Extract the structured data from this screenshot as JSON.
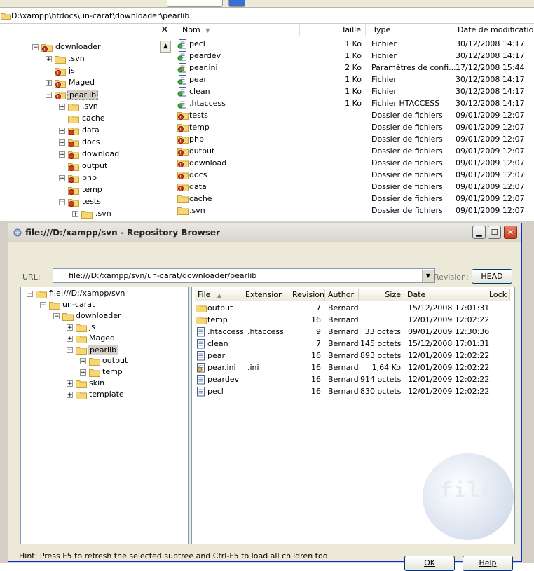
{
  "explorer": {
    "address": "D:\\xampp\\htdocs\\un-carat\\downloader\\pearlib",
    "folders_close": "×",
    "tree": [
      {
        "label": "downloader",
        "level": 0,
        "pm": "−",
        "icon": "folder-svn-icon"
      },
      {
        "label": ".svn",
        "level": 1,
        "pm": "+",
        "icon": "folder-icon"
      },
      {
        "label": "js",
        "level": 1,
        "pm": "",
        "icon": "folder-svn-icon"
      },
      {
        "label": "Maged",
        "level": 1,
        "pm": "+",
        "icon": "folder-svn-icon"
      },
      {
        "label": "pearlib",
        "level": 1,
        "pm": "−",
        "icon": "folder-svn-icon",
        "selected": true
      },
      {
        "label": ".svn",
        "level": 2,
        "pm": "+",
        "icon": "folder-icon"
      },
      {
        "label": "cache",
        "level": 2,
        "pm": "",
        "icon": "folder-icon"
      },
      {
        "label": "data",
        "level": 2,
        "pm": "+",
        "icon": "folder-svn-icon"
      },
      {
        "label": "docs",
        "level": 2,
        "pm": "+",
        "icon": "folder-svn-icon"
      },
      {
        "label": "download",
        "level": 2,
        "pm": "+",
        "icon": "folder-svn-icon"
      },
      {
        "label": "output",
        "level": 2,
        "pm": "",
        "icon": "folder-svn-icon"
      },
      {
        "label": "php",
        "level": 2,
        "pm": "+",
        "icon": "folder-svn-icon"
      },
      {
        "label": "temp",
        "level": 2,
        "pm": "",
        "icon": "folder-svn-icon"
      },
      {
        "label": "tests",
        "level": 2,
        "pm": "−",
        "icon": "folder-svn-icon"
      },
      {
        "label": ".svn",
        "level": 3,
        "pm": "+",
        "icon": "folder-icon"
      }
    ],
    "columns": {
      "name": "Nom",
      "size": "Taille",
      "type": "Type",
      "modified": "Date de modification"
    },
    "rows": [
      {
        "name": "pecl",
        "size": "1 Ko",
        "type": "Fichier",
        "modified": "30/12/2008 14:17"
      },
      {
        "name": "peardev",
        "size": "1 Ko",
        "type": "Fichier",
        "modified": "30/12/2008 14:17"
      },
      {
        "name": "pear.ini",
        "size": "2 Ko",
        "type": "Paramètres de confi...",
        "modified": "17/12/2008 15:44"
      },
      {
        "name": "pear",
        "size": "1 Ko",
        "type": "Fichier",
        "modified": "30/12/2008 14:17"
      },
      {
        "name": "clean",
        "size": "1 Ko",
        "type": "Fichier",
        "modified": "30/12/2008 14:17"
      },
      {
        "name": ".htaccess",
        "size": "1 Ko",
        "type": "Fichier HTACCESS",
        "modified": "30/12/2008 14:17"
      },
      {
        "name": "tests",
        "size": "",
        "type": "Dossier de fichiers",
        "modified": "09/01/2009 12:07"
      },
      {
        "name": "temp",
        "size": "",
        "type": "Dossier de fichiers",
        "modified": "09/01/2009 12:07"
      },
      {
        "name": "php",
        "size": "",
        "type": "Dossier de fichiers",
        "modified": "09/01/2009 12:07"
      },
      {
        "name": "output",
        "size": "",
        "type": "Dossier de fichiers",
        "modified": "09/01/2009 12:07"
      },
      {
        "name": "download",
        "size": "",
        "type": "Dossier de fichiers",
        "modified": "09/01/2009 12:07"
      },
      {
        "name": "docs",
        "size": "",
        "type": "Dossier de fichiers",
        "modified": "09/01/2009 12:07"
      },
      {
        "name": "data",
        "size": "",
        "type": "Dossier de fichiers",
        "modified": "09/01/2009 12:07"
      },
      {
        "name": "cache",
        "size": "",
        "type": "Dossier de fichiers",
        "modified": "09/01/2009 12:07"
      },
      {
        "name": ".svn",
        "size": "",
        "type": "Dossier de fichiers",
        "modified": "09/01/2009 12:07"
      }
    ],
    "row_icons": [
      "file-svn-icon",
      "file-svn-icon",
      "settings-file-svn-icon",
      "file-svn-icon",
      "file-svn-icon",
      "file-svn-icon",
      "folder-svn-icon",
      "folder-svn-icon",
      "folder-svn-icon",
      "folder-svn-icon",
      "folder-svn-icon",
      "folder-svn-icon",
      "folder-svn-icon",
      "folder-icon",
      "folder-icon"
    ]
  },
  "dialog": {
    "title": "file:///D:/xampp/svn - Repository Browser",
    "url_label": "URL:",
    "url_value": "file:///D:/xampp/svn/un-carat/downloader/pearlib",
    "revision_label": "Revision:",
    "head_button": "HEAD",
    "tree": [
      {
        "label": "file:///D:/xampp/svn",
        "level": 0,
        "pm": "−"
      },
      {
        "label": "un-carat",
        "level": 1,
        "pm": "−"
      },
      {
        "label": "downloader",
        "level": 2,
        "pm": "−"
      },
      {
        "label": "js",
        "level": 3,
        "pm": "+"
      },
      {
        "label": "Maged",
        "level": 3,
        "pm": "+"
      },
      {
        "label": "pearlib",
        "level": 3,
        "pm": "−",
        "selected": true
      },
      {
        "label": "output",
        "level": 4,
        "pm": "+"
      },
      {
        "label": "temp",
        "level": 4,
        "pm": "+"
      },
      {
        "label": "skin",
        "level": 3,
        "pm": "+"
      },
      {
        "label": "template",
        "level": 3,
        "pm": "+"
      }
    ],
    "columns": {
      "file": "File",
      "extension": "Extension",
      "revision": "Revision",
      "author": "Author",
      "size": "Size",
      "date": "Date",
      "lock": "Lock"
    },
    "files": [
      {
        "file": "output",
        "extension": "",
        "revision": "7",
        "author": "Bernard",
        "size": "",
        "date": "15/12/2008 17:01:31",
        "icon": "folder-icon"
      },
      {
        "file": "temp",
        "extension": "",
        "revision": "16",
        "author": "Bernard",
        "size": "",
        "date": "12/01/2009 12:02:22",
        "icon": "folder-icon"
      },
      {
        "file": ".htaccess",
        "extension": ".htaccess",
        "revision": "9",
        "author": "Bernard",
        "size": "33 octets",
        "date": "09/01/2009 12:30:36",
        "icon": "file-icon"
      },
      {
        "file": "clean",
        "extension": "",
        "revision": "7",
        "author": "Bernard",
        "size": "145 octets",
        "date": "15/12/2008 17:01:31",
        "icon": "file-icon"
      },
      {
        "file": "pear",
        "extension": "",
        "revision": "16",
        "author": "Bernard",
        "size": "893 octets",
        "date": "12/01/2009 12:02:22",
        "icon": "file-icon"
      },
      {
        "file": "pear.ini",
        "extension": ".ini",
        "revision": "16",
        "author": "Bernard",
        "size": "1,64 Ko",
        "date": "12/01/2009 12:02:22",
        "icon": "settings-file-icon"
      },
      {
        "file": "peardev",
        "extension": "",
        "revision": "16",
        "author": "Bernard",
        "size": "914 octets",
        "date": "12/01/2009 12:02:22",
        "icon": "file-icon"
      },
      {
        "file": "pecl",
        "extension": "",
        "revision": "16",
        "author": "Bernard",
        "size": "830 octets",
        "date": "12/01/2009 12:02:22",
        "icon": "file-icon"
      }
    ],
    "hint": "Hint: Press F5 to refresh the selected subtree and Ctrl-F5 to load all children too",
    "ok_button": "OK",
    "help_button": "Help",
    "watermark": "file"
  },
  "colors": {
    "folder": "#f7d774",
    "folder_border": "#c9a13b",
    "svn_ok": "#3fae3f",
    "svn_mod": "#d63a2a",
    "dialog_frame": "#0831d9",
    "selection": "#d4d0c8"
  }
}
